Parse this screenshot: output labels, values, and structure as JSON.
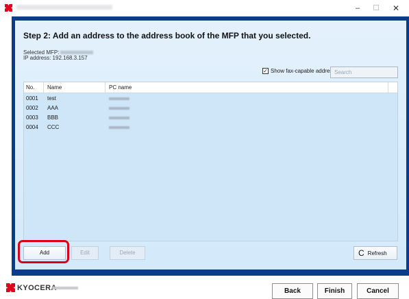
{
  "window": {
    "title_blurred": true,
    "controls": {
      "minimize": "–",
      "maximize": "☐",
      "close": "✕"
    }
  },
  "heading": "Step 2: Add an address to the address book of the MFP that you selected.",
  "selected_mfp": {
    "label": "Selected MFP:"
  },
  "ip_address": {
    "label": "IP address: 192.168.3.157"
  },
  "fax_option": {
    "label": "Show fax-capable addresses",
    "checked": true,
    "check_glyph": "✓"
  },
  "search": {
    "placeholder": "Search"
  },
  "table": {
    "columns": {
      "no": "No.",
      "name": "Name",
      "pc": "PC name"
    },
    "rows": [
      {
        "no": "0001",
        "name": "test"
      },
      {
        "no": "0002",
        "name": "AAA"
      },
      {
        "no": "0003",
        "name": "BBB"
      },
      {
        "no": "0004",
        "name": "CCC"
      }
    ]
  },
  "buttons": {
    "add": "Add",
    "edit": "Edit",
    "delete": "Delete",
    "refresh": "Refresh",
    "refresh_icon": "C"
  },
  "footer": {
    "brand": "KYOCERA",
    "back": "Back",
    "finish": "Finish",
    "cancel": "Cancel"
  },
  "colors": {
    "frame": "#0b3c8c",
    "highlight": "#d9001b",
    "logo_red": "#e3001b"
  }
}
